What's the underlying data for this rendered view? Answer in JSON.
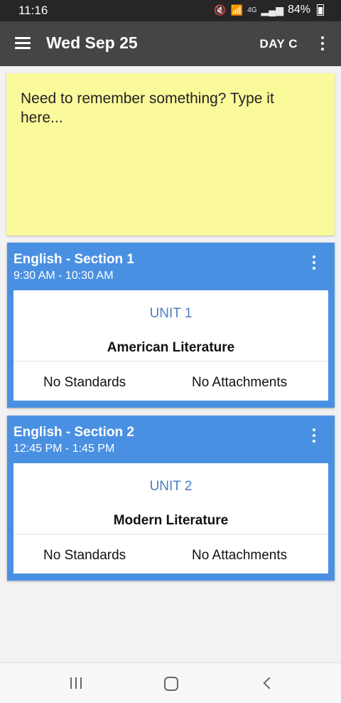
{
  "status_bar": {
    "time": "11:16",
    "network": "4G",
    "battery": "84%"
  },
  "app_bar": {
    "title": "Wed Sep 25",
    "day": "DAY C"
  },
  "note": {
    "placeholder": "Need to remember something? Type it here..."
  },
  "classes": [
    {
      "title": "English - Section 1",
      "time": "9:30 AM - 10:30 AM",
      "unit": "UNIT 1",
      "topic": "American Literature",
      "standards": "No Standards",
      "attachments": "No Attachments"
    },
    {
      "title": "English - Section 2",
      "time": "12:45 PM - 1:45 PM",
      "unit": "UNIT 2",
      "topic": "Modern Literature",
      "standards": "No Standards",
      "attachments": "No Attachments"
    }
  ],
  "colors": {
    "status_bar": "#262626",
    "app_bar": "#454545",
    "note_bg": "#fafa9b",
    "card_accent": "#4a90e2",
    "unit_text": "#4a7fc1"
  },
  "icons": {
    "menu": "hamburger-menu-icon",
    "overflow": "more-vert-icon",
    "recents": "recent-apps-icon",
    "home": "home-icon",
    "back": "back-chevron-icon"
  }
}
